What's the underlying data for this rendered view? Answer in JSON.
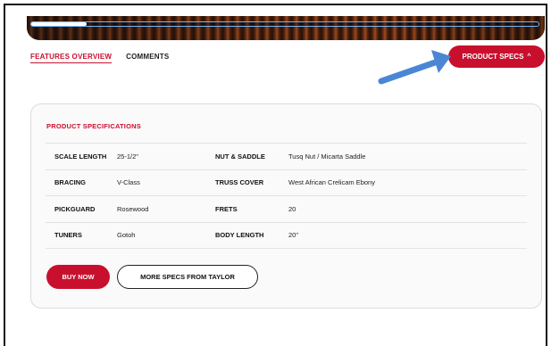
{
  "hero": {
    "progress": 0.11
  },
  "tabs": [
    {
      "label": "FEATURES OVERVIEW",
      "active": true
    },
    {
      "label": "COMMENTS",
      "active": false
    }
  ],
  "product_specs_button": {
    "label": "PRODUCT SPECS",
    "chevron": "^"
  },
  "specs": {
    "title": "PRODUCT SPECIFICATIONS",
    "rows": [
      {
        "k1": "SCALE LENGTH",
        "v1": "25-1/2\"",
        "k2": "NUT & SADDLE",
        "v2": "Tusq Nut / Micarta Saddle"
      },
      {
        "k1": "BRACING",
        "v1": "V-Class",
        "k2": "TRUSS COVER",
        "v2": "West African Crelicam Ebony"
      },
      {
        "k1": "PICKGUARD",
        "v1": "Rosewood",
        "k2": "FRETS",
        "v2": "20"
      },
      {
        "k1": "TUNERS",
        "v1": "Gotoh",
        "k2": "BODY LENGTH",
        "v2": "20\""
      }
    ]
  },
  "actions": {
    "buy_now": "BUY NOW",
    "more_specs": "MORE SPECS FROM TAYLOR"
  },
  "colors": {
    "accent": "#c8102e",
    "annotation_arrow": "#4a86d4",
    "progress_border": "#6fb7ff"
  }
}
